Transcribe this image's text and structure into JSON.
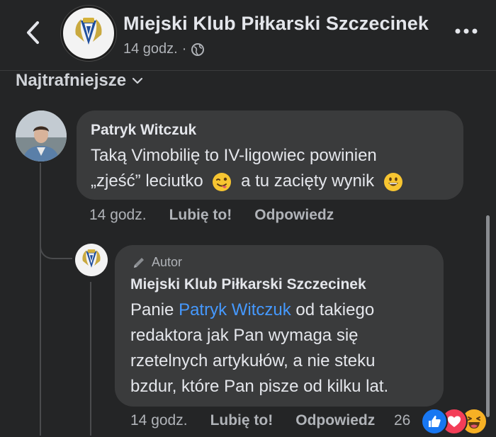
{
  "header": {
    "page_name": "Miejski Klub Piłkarski Szczecinek",
    "time": "14 godz.",
    "separator": "·",
    "privacy_icon": "globe-icon",
    "back_icon": "chevron-left-icon",
    "more_icon": "more-horizontal-icon"
  },
  "sort": {
    "label": "Najtrafniejsze",
    "icon": "chevron-down-icon"
  },
  "comment": {
    "author": "Patryk Witczuk",
    "line1": "Taką Vimobilię to IV-ligowiec powinien",
    "line2_a": "„zjeść” leciutko",
    "line2_b": "a tu zacięty wynik",
    "emoji1": "winking-face-with-tongue-emoji",
    "emoji2": "grinning-face-emoji",
    "time": "14 godz.",
    "like_label": "Lubię to!",
    "reply_label": "Odpowiedz"
  },
  "reply": {
    "badge": "Autor",
    "badge_icon": "pencil-icon",
    "author": "Miejski Klub Piłkarski Szczecinek",
    "text_before": "Panie",
    "mention": "Patryk Witczuk",
    "text_after": "od takiego",
    "line2": "redaktora jak Pan wymaga się",
    "line3": "rzetelnych artykułów, a nie steku",
    "line4": "bzdur, które Pan pisze od kilku lat.",
    "time": "14 godz.",
    "like_label": "Lubię to!",
    "reply_label": "Odpowiedz",
    "reaction_count": "26",
    "reactions": [
      "like-reaction-icon",
      "love-reaction-icon",
      "haha-reaction-icon"
    ]
  },
  "colors": {
    "background": "#242526",
    "bubble": "#3a3b3c",
    "link": "#4599ff",
    "like": "#1877f2",
    "love": "#f33e58",
    "haha": "#f7b125"
  }
}
